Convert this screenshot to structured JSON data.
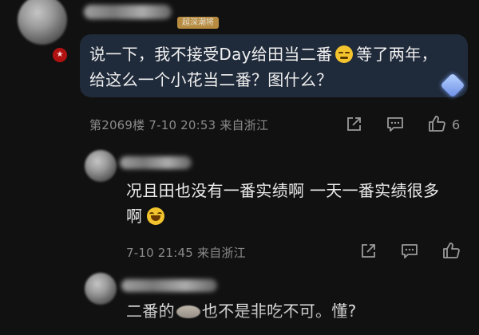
{
  "comments": [
    {
      "tag": "超深潮将",
      "text_parts": [
        "说一下，我不接受Day给田当二番",
        "等了两年，给这么一个小花当二番？图什么？"
      ],
      "emoji": "grimace-emoji",
      "meta": "第2069楼 7-10 20:53 来自浙江",
      "likes": "6"
    },
    {
      "text_parts": [
        "况且田也没有一番实绩啊 一天一番实绩很多啊"
      ],
      "emoji": "laughing-emoji",
      "meta": "7-10 21:45 来自浙江"
    },
    {
      "text_parts": [
        "二番的",
        "也不是非吃不可。懂?"
      ],
      "emoji": "sticker-emoji"
    }
  ]
}
